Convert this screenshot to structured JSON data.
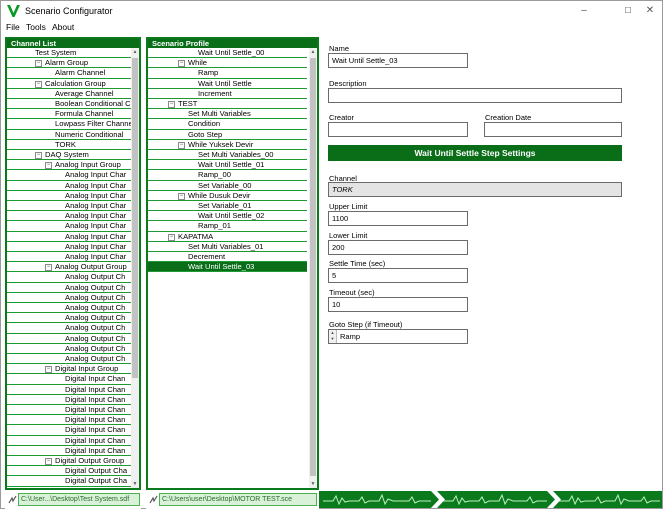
{
  "window": {
    "title": "Scenario Configurator",
    "minimize": "–",
    "maximize": "☐",
    "close": "✕"
  },
  "menu": {
    "items": [
      "File",
      "Tools",
      "About"
    ]
  },
  "channel_list": {
    "header": "Channel List",
    "rows": [
      {
        "label": "Test System",
        "level": 0,
        "toggle": "root"
      },
      {
        "label": "Alarm Group",
        "level": 1,
        "toggle": "−"
      },
      {
        "label": "Alarm Channel",
        "level": 2
      },
      {
        "label": "Calculation Group",
        "level": 1,
        "toggle": "−"
      },
      {
        "label": "Average Channel",
        "level": 2
      },
      {
        "label": "Boolean Conditional C",
        "level": 2
      },
      {
        "label": "Formula Channel",
        "level": 2
      },
      {
        "label": "Lowpass Filter Channe",
        "level": 2
      },
      {
        "label": "Numeric Conditional",
        "level": 2
      },
      {
        "label": "TORK",
        "level": 2
      },
      {
        "label": "DAQ System",
        "level": 1,
        "toggle": "−"
      },
      {
        "label": "Analog Input Group",
        "level": 2,
        "toggle": "−"
      },
      {
        "label": "Analog Input Char",
        "level": 3
      },
      {
        "label": "Analog Input Char",
        "level": 3
      },
      {
        "label": "Analog Input Char",
        "level": 3
      },
      {
        "label": "Analog Input Char",
        "level": 3
      },
      {
        "label": "Analog Input Char",
        "level": 3
      },
      {
        "label": "Analog Input Char",
        "level": 3
      },
      {
        "label": "Analog Input Char",
        "level": 3
      },
      {
        "label": "Analog Input Char",
        "level": 3
      },
      {
        "label": "Analog Input Char",
        "level": 3
      },
      {
        "label": "Analog Output Group",
        "level": 2,
        "toggle": "−"
      },
      {
        "label": "Analog Output Ch",
        "level": 3
      },
      {
        "label": "Analog Output Ch",
        "level": 3
      },
      {
        "label": "Analog Output Ch",
        "level": 3
      },
      {
        "label": "Analog Output Ch",
        "level": 3
      },
      {
        "label": "Analog Output Ch",
        "level": 3
      },
      {
        "label": "Analog Output Ch",
        "level": 3
      },
      {
        "label": "Analog Output Ch",
        "level": 3
      },
      {
        "label": "Analog Output Ch",
        "level": 3
      },
      {
        "label": "Analog Output Ch",
        "level": 3
      },
      {
        "label": "Digital Input Group",
        "level": 2,
        "toggle": "−"
      },
      {
        "label": "Digital Input Chan",
        "level": 3
      },
      {
        "label": "Digital Input Chan",
        "level": 3
      },
      {
        "label": "Digital Input Chan",
        "level": 3
      },
      {
        "label": "Digital Input Chan",
        "level": 3
      },
      {
        "label": "Digital Input Chan",
        "level": 3
      },
      {
        "label": "Digital Input Chan",
        "level": 3
      },
      {
        "label": "Digital Input Chan",
        "level": 3
      },
      {
        "label": "Digital Input Chan",
        "level": 3
      },
      {
        "label": "Digital Output Group",
        "level": 2,
        "toggle": "−"
      },
      {
        "label": "Digital Output Cha",
        "level": 3
      },
      {
        "label": "Digital Output Cha",
        "level": 3
      },
      {
        "label": "Digital Output Cha",
        "level": 3
      }
    ],
    "status_path": "C:\\User...\\Desktop\\Test System.sdf"
  },
  "scenario_profile": {
    "header": "Scenario Profile",
    "rows": [
      {
        "label": "Wait Until Settle_00",
        "level": 2
      },
      {
        "label": "While",
        "level": 1,
        "toggle": "−"
      },
      {
        "label": "Ramp",
        "level": 2
      },
      {
        "label": "Wait Until Settle",
        "level": 2
      },
      {
        "label": "Increment",
        "level": 2
      },
      {
        "label": "TEST",
        "level": 0,
        "toggle": "−"
      },
      {
        "label": "Set Multi Variables",
        "level": 1
      },
      {
        "label": "Condition",
        "level": 1
      },
      {
        "label": "Goto Step",
        "level": 1
      },
      {
        "label": "While Yuksek Devir",
        "level": 1,
        "toggle": "−"
      },
      {
        "label": "Set Multi Variables_00",
        "level": 2
      },
      {
        "label": "Wait Until Settle_01",
        "level": 2
      },
      {
        "label": "Ramp_00",
        "level": 2
      },
      {
        "label": "Set Variable_00",
        "level": 2
      },
      {
        "label": "While Dusuk Devir",
        "level": 1,
        "toggle": "−"
      },
      {
        "label": "Set Variable_01",
        "level": 2
      },
      {
        "label": "Wait Until Settle_02",
        "level": 2
      },
      {
        "label": "Ramp_01",
        "level": 2
      },
      {
        "label": "KAPATMA",
        "level": 0,
        "toggle": "−"
      },
      {
        "label": "Set Multi Variables_01",
        "level": 1
      },
      {
        "label": "Decrement",
        "level": 1
      },
      {
        "label": "Wait Until Settle_03",
        "level": 1,
        "selected": true
      }
    ],
    "status_path": "C:\\Users\\user\\Desktop\\MOTOR TEST.sce"
  },
  "properties": {
    "name_label": "Name",
    "name_value": "Wait Until Settle_03",
    "description_label": "Description",
    "description_value": "",
    "creator_label": "Creator",
    "creator_value": "",
    "creation_date_label": "Creation Date",
    "creation_date_value": "",
    "settings_title": "Wait Until Settle Step Settings",
    "channel_label": "Channel",
    "channel_value": "TORK",
    "upper_limit_label": "Upper Limit",
    "upper_limit_value": "1100",
    "lower_limit_label": "Lower Limit",
    "lower_limit_value": "200",
    "settle_time_label": "Settle Time (sec)",
    "settle_time_value": "5",
    "timeout_label": "Timeout (sec)",
    "timeout_value": "10",
    "goto_step_label": "Goto Step (if Timeout)",
    "goto_step_value": "Ramp"
  },
  "colors": {
    "accent": "#0a6e19",
    "row_line": "#1e9a34",
    "status_bg": "#d8f1d8"
  },
  "icons": {
    "app": "green-v-logo",
    "status": "link-icon",
    "wave": "signal-wave-icon"
  }
}
